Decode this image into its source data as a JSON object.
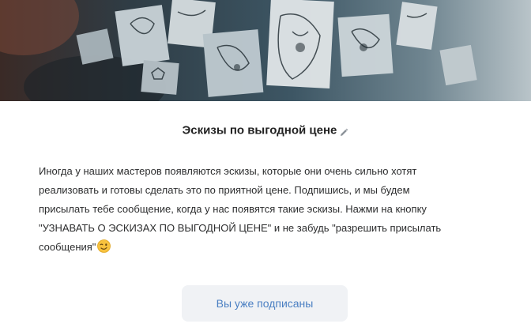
{
  "cover": {
    "image": "tattoo-sketches-wall-photo"
  },
  "header": {
    "title": "Эскизы по выгодной цене",
    "edit_icon": "pencil-icon"
  },
  "description": {
    "text": "Иногда у наших мастеров появляются эскизы, которые они очень сильно хотят\nреализовать и готовы сделать это по приятной цене. Подпишись, и мы будем\nприсылать тебе сообщение, когда у нас появятся такие эскизы. Нажми на кнопку\n\"УЗНАВАТЬ О ЭСКИЗАХ ПО ВЫГОДНОЙ ЦЕНЕ\" и не забудь \"разрешить присылать\nсообщения\"",
    "emoji": "winking-face-emoji"
  },
  "actions": {
    "subscribed_label": "Вы уже подписаны"
  },
  "colors": {
    "accent": "#4a7fc2",
    "button_bg": "#f0f2f5",
    "text": "#2c2d2e"
  }
}
